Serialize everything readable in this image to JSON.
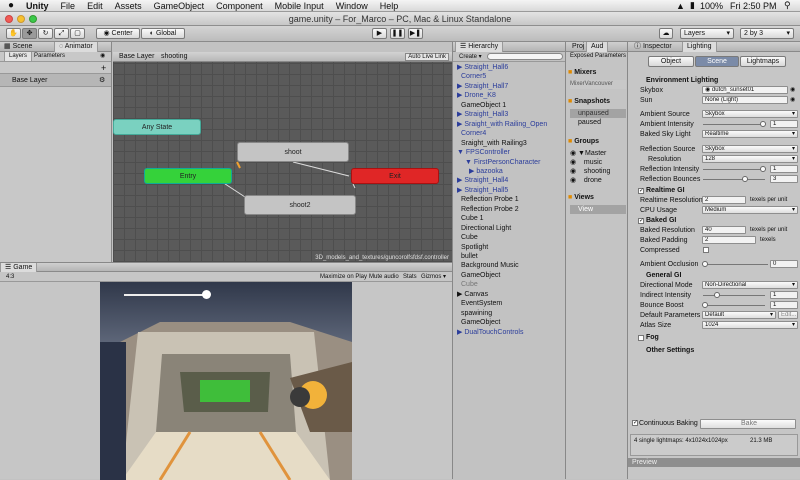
{
  "menubar": {
    "apple": "",
    "app": "Unity",
    "items": [
      "File",
      "Edit",
      "Assets",
      "GameObject",
      "Component",
      "Mobile Input",
      "Window",
      "Help"
    ],
    "clock": "Fri 2:50 PM",
    "battery": "100%"
  },
  "window": {
    "title": "game.unity – For_Marco – PC, Mac & Linux Standalone"
  },
  "toolbar": {
    "center": "Center",
    "global": "Global",
    "layers": "Layers",
    "layout": "2 by 3"
  },
  "scene_panel": {
    "tab_scene": "Scene",
    "tab_animator": "Animator",
    "sub_layers": "Layers",
    "sub_params": "Parameters",
    "layer_name": "Base Layer",
    "plus": "+"
  },
  "animator": {
    "breadcrumb_base": "Base Layer",
    "breadcrumb_state": "shooting",
    "auto_live": "Auto Live Link",
    "any_state": "Any State",
    "entry": "Entry",
    "shoot": "shoot",
    "exit": "Exit",
    "shoot2": "shoot2",
    "footer_path": "3D_models_and_textures/guncorolfsfdsf.controller"
  },
  "game": {
    "tab": "Game",
    "aspect": "4:3",
    "maximize": "Maximize on Play",
    "mute": "Mute audio",
    "stats": "Stats",
    "gizmos": "Gizmos ▾"
  },
  "hierarchy": {
    "tab": "Hierarchy",
    "create": "Create ▾",
    "items": [
      {
        "label": "▶ Straight_Hall6",
        "color": "blue",
        "indent": 0
      },
      {
        "label": "Corner5",
        "color": "blue",
        "indent": 1
      },
      {
        "label": "▶ Straight_Hall7",
        "color": "blue",
        "indent": 0
      },
      {
        "label": "▶ Drone_K8",
        "color": "blue",
        "indent": 0
      },
      {
        "label": "GameObject 1",
        "color": "black",
        "indent": 1
      },
      {
        "label": "▶ Straight_Hall3",
        "color": "blue",
        "indent": 0
      },
      {
        "label": "▶ Sraight_with Railing_Open",
        "color": "blue",
        "indent": 0
      },
      {
        "label": "Corner4",
        "color": "blue",
        "indent": 1
      },
      {
        "label": "Sraight_with Railing3",
        "color": "black",
        "indent": 1
      },
      {
        "label": "▼ FPSController",
        "color": "blue",
        "indent": 0
      },
      {
        "label": "▼ FirstPersonCharacter",
        "color": "blue",
        "indent": 2
      },
      {
        "label": "▶ bazooka",
        "color": "blue",
        "indent": 3
      },
      {
        "label": "▶ Straight_Hall4",
        "color": "blue",
        "indent": 0
      },
      {
        "label": "▶ Straight_Hall5",
        "color": "blue",
        "indent": 0
      },
      {
        "label": "Reflection Probe 1",
        "color": "black",
        "indent": 1
      },
      {
        "label": "Reflection Probe 2",
        "color": "black",
        "indent": 1
      },
      {
        "label": "Cube 1",
        "color": "black",
        "indent": 1
      },
      {
        "label": "Directional Light",
        "color": "black",
        "indent": 1
      },
      {
        "label": "Cube",
        "color": "black",
        "indent": 1
      },
      {
        "label": "Spotlight",
        "color": "black",
        "indent": 1
      },
      {
        "label": "bullet",
        "color": "black",
        "indent": 1
      },
      {
        "label": "Background Music",
        "color": "black",
        "indent": 1
      },
      {
        "label": "GameObject",
        "color": "black",
        "indent": 1
      },
      {
        "label": "Cube",
        "color": "gray",
        "indent": 1
      },
      {
        "label": "▶ Canvas",
        "color": "black",
        "indent": 0
      },
      {
        "label": "EventSystem",
        "color": "black",
        "indent": 1
      },
      {
        "label": "spawining",
        "color": "black",
        "indent": 1
      },
      {
        "label": "GameObject",
        "color": "black",
        "indent": 1
      },
      {
        "label": "▶ DualTouchControls",
        "color": "blue",
        "indent": 0
      }
    ]
  },
  "audio": {
    "tab_proj": "Proj",
    "tab_aud": "Aud",
    "exposed": "Exposed Parameters",
    "mixers": "Mixers",
    "mixer_name": "MixerVancouver",
    "snapshots": "Snapshots",
    "unpaused": "unpaused",
    "paused": "paused",
    "groups": "Groups",
    "master": "Master",
    "music": "music",
    "shooting": "shooting",
    "drone": "drone",
    "views": "Views",
    "view": "View"
  },
  "inspector": {
    "tab_inspector": "Inspector",
    "tab_lighting": "Lighting",
    "btn_object": "Object",
    "btn_scene": "Scene",
    "btn_lightmaps": "Lightmaps",
    "env_title": "Environment Lighting",
    "skybox_label": "Skybox",
    "skybox_value": "dutch_sunset01",
    "sun_label": "Sun",
    "sun_value": "None (Light)",
    "amb_src_label": "Ambient Source",
    "amb_src_value": "Skybox",
    "amb_int_label": "Ambient Intensity",
    "amb_int_value": "1",
    "baked_sky_label": "Baked Sky Light",
    "baked_sky_value": "Realtime",
    "refl_src_label": "Reflection Source",
    "refl_src_value": "Skybox",
    "res_label": "Resolution",
    "res_value": "128",
    "refl_int_label": "Reflection Intensity",
    "refl_int_value": "1",
    "refl_b_label": "Reflection Bounces",
    "refl_b_value": "3",
    "realtime_gi": "Realtime GI",
    "rt_res_label": "Realtime Resolution",
    "rt_res_value": "2",
    "rt_res_unit": "texels per unit",
    "cpu_label": "CPU Usage",
    "cpu_value": "Medium",
    "baked_gi": "Baked GI",
    "bk_res_label": "Baked Resolution",
    "bk_res_value": "40",
    "bk_res_unit": "texels per unit",
    "bk_pad_label": "Baked Padding",
    "bk_pad_value": "2",
    "bk_pad_unit": "texels",
    "compressed_label": "Compressed",
    "ao_label": "Ambient Occlusion",
    "ao_value": "0",
    "general_gi": "General GI",
    "dir_label": "Directional Mode",
    "dir_value": "Non-Directional",
    "ind_label": "Indirect Intensity",
    "ind_value": "1",
    "bb_label": "Bounce Boost",
    "bb_value": "1",
    "dp_label": "Default Parameters",
    "dp_value": "Default",
    "edit": "Edit...",
    "atlas_label": "Atlas Size",
    "atlas_value": "1024",
    "fog": "Fog",
    "other": "Other Settings",
    "cont_bake": "Continuous Baking",
    "bake": "Bake",
    "lightmap_info": "4 single lightmaps: 4x1024x1024px",
    "lightmap_size": "21.3 MB",
    "preview": "Preview"
  }
}
